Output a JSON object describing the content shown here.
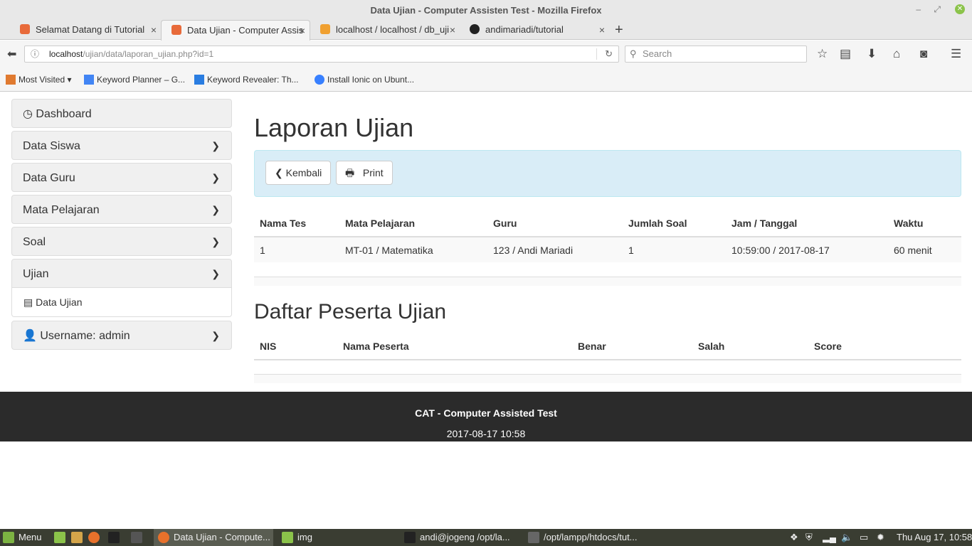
{
  "window": {
    "title": "Data Ujian - Computer Assisten Test - Mozilla Firefox"
  },
  "tabs": [
    {
      "label": "Selamat Datang di Tutorial",
      "active": false
    },
    {
      "label": "Data Ujian - Computer Assis",
      "active": true
    },
    {
      "label": "localhost / localhost / db_uji",
      "active": false
    },
    {
      "label": "andimariadi/tutorial",
      "active": false
    }
  ],
  "nav": {
    "url_host": "localhost",
    "url_path": "/ujian/data/laporan_ujian.php?id=1",
    "search_placeholder": "Search"
  },
  "bookmarks": [
    {
      "label": "Most Visited"
    },
    {
      "label": "Keyword Planner – G..."
    },
    {
      "label": "Keyword Revealer: Th..."
    },
    {
      "label": "Install Ionic on Ubunt..."
    }
  ],
  "sidebar": {
    "dashboard": "Dashboard",
    "items": [
      "Data Siswa",
      "Data Guru",
      "Mata Pelajaran",
      "Soal",
      "Ujian"
    ],
    "sub_item": "Data Ujian",
    "user": "Username: admin"
  },
  "main": {
    "title": "Laporan Ujian",
    "back_label": "Kembali",
    "print_label": "Print",
    "exam_headers": [
      "Nama Tes",
      "Mata Pelajaran",
      "Guru",
      "Jumlah Soal",
      "Jam / Tanggal",
      "Waktu"
    ],
    "exam_row": [
      "1",
      "MT-01 / Matematika",
      "123 / Andi Mariadi",
      "1",
      "10:59:00 / 2017-08-17",
      "60 menit"
    ],
    "participants_title": "Daftar Peserta Ujian",
    "participant_headers": [
      "NIS",
      "Nama Peserta",
      "Benar",
      "Salah",
      "Score"
    ]
  },
  "footer": {
    "title": "CAT - Computer Assisted Test",
    "datetime": "2017-08-17 10:58"
  },
  "taskbar": {
    "menu": "Menu",
    "items": [
      "Data Ujian - Compute...",
      "img",
      "andi@jogeng /opt/la...",
      "/opt/lampp/htdocs/tut..."
    ],
    "clock": "Thu Aug 17, 10:58"
  }
}
